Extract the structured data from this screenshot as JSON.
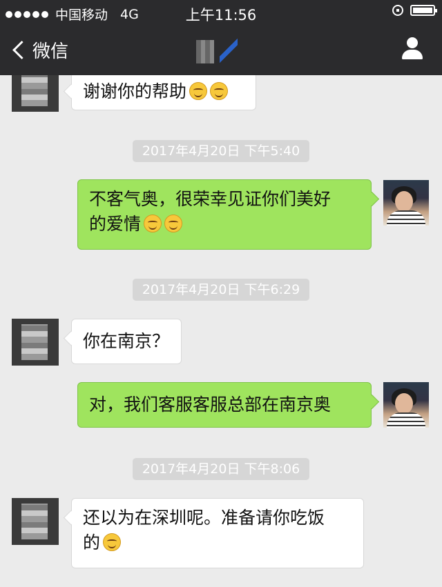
{
  "status_bar": {
    "carrier": "中国移动",
    "network": "4G",
    "time": "上午11:56"
  },
  "nav": {
    "back_label": "微信"
  },
  "messages": [
    {
      "side": "in",
      "text": "谢谢你的帮助",
      "emoji_count": 2
    },
    {
      "type": "timestamp",
      "text": "2017年4月20日 下午5:40"
    },
    {
      "side": "out",
      "line1": "不客气奥，很荣幸见证你们美好",
      "line2": "的爱情",
      "emoji_count": 2
    },
    {
      "type": "timestamp",
      "text": "2017年4月20日 下午6:29"
    },
    {
      "side": "in",
      "text": "你在南京？"
    },
    {
      "side": "out",
      "text": "对，我们客服客服总部在南京奥"
    },
    {
      "type": "timestamp",
      "text": "2017年4月20日 下午8:06"
    },
    {
      "side": "in",
      "line1": "还以为在深圳呢。准备请你吃饭",
      "line2": "的",
      "emoji_count": 1
    }
  ],
  "colors": {
    "header_bg": "#2b2b2d",
    "chat_bg": "#ebebeb",
    "outgoing_bubble": "#9fe45e",
    "incoming_bubble": "#ffffff"
  }
}
